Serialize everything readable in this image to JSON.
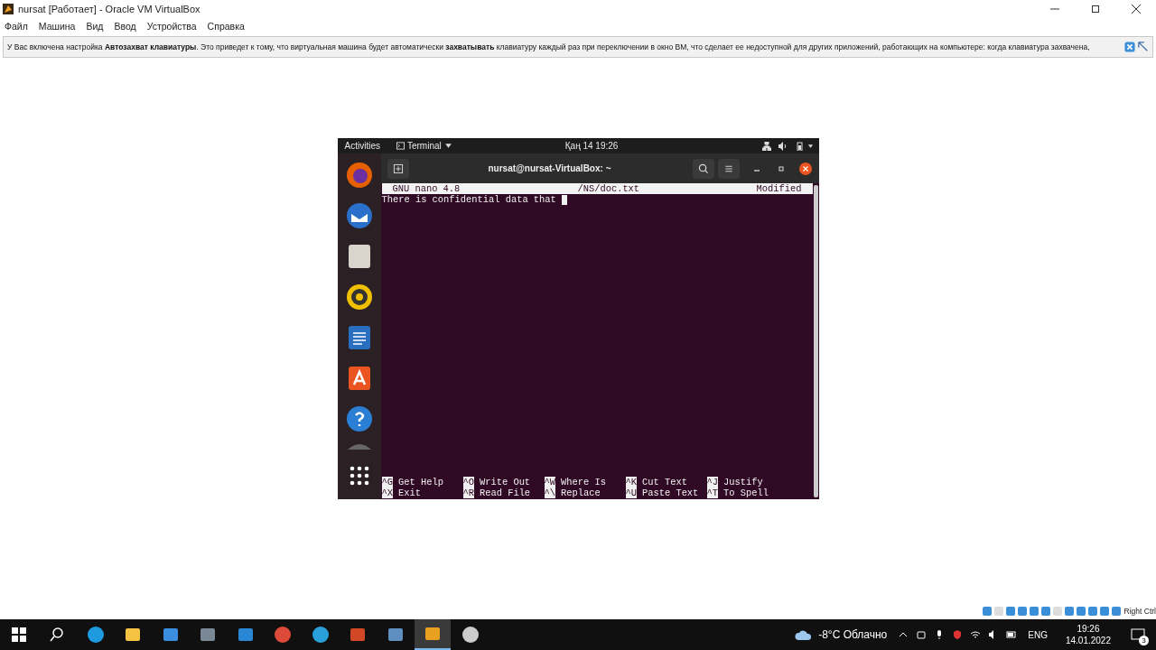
{
  "window": {
    "title": "nursat [Работает] - Oracle VM VirtualBox"
  },
  "menu": [
    "Файл",
    "Машина",
    "Вид",
    "Ввод",
    "Устройства",
    "Справка"
  ],
  "notification": {
    "text": "У Вас включена настройка **Автозахват клавиатуры**. Это приведет к тому, что виртуальная машина будет автоматически **захватывать** клавиатуру каждый раз при переключении в окно ВМ, что сделает ее недоступной для других приложений, работающих на компьютере: когда клавиатура захвачена,"
  },
  "vm": {
    "topbar": {
      "activities": "Activities",
      "app": "Terminal",
      "clock": "Қаң 14  19:26"
    },
    "dock": [
      {
        "kind": "firefox"
      },
      {
        "kind": "thunderbird"
      },
      {
        "kind": "files"
      },
      {
        "kind": "rhythmbox"
      },
      {
        "kind": "writer"
      },
      {
        "kind": "software"
      },
      {
        "kind": "help"
      },
      {
        "kind": "partial"
      },
      {
        "kind": "grid"
      }
    ],
    "terminal": {
      "title": "nursat@nursat-VirtualBox: ~",
      "nano": {
        "app": "GNU nano 4.8",
        "file": "/NS/doc.txt",
        "status": "Modified"
      },
      "lines": [
        "There is confidential data that"
      ],
      "shortcuts": [
        [
          {
            "key": "^G",
            "label": "Get Help"
          },
          {
            "key": "^X",
            "label": "Exit"
          }
        ],
        [
          {
            "key": "^O",
            "label": "Write Out"
          },
          {
            "key": "^R",
            "label": "Read File"
          }
        ],
        [
          {
            "key": "^W",
            "label": "Where Is"
          },
          {
            "key": "^\\",
            "label": "Replace"
          }
        ],
        [
          {
            "key": "^K",
            "label": "Cut Text"
          },
          {
            "key": "^U",
            "label": "Paste Text"
          }
        ],
        [
          {
            "key": "^J",
            "label": "Justify"
          },
          {
            "key": "^T",
            "label": "To Spell"
          }
        ]
      ]
    }
  },
  "host_key": "Right Ctrl",
  "taskbar": {
    "apps": [
      {
        "kind": "edge",
        "selected": false
      },
      {
        "kind": "explorer",
        "selected": false
      },
      {
        "kind": "store",
        "selected": false
      },
      {
        "kind": "camera",
        "selected": false
      },
      {
        "kind": "mail",
        "selected": false
      },
      {
        "kind": "chrome",
        "selected": false
      },
      {
        "kind": "telegram",
        "selected": false
      },
      {
        "kind": "powerpoint",
        "selected": false
      },
      {
        "kind": "virtualbox",
        "selected": false
      },
      {
        "kind": "vm",
        "selected": true
      },
      {
        "kind": "obs",
        "selected": false
      }
    ],
    "weather": "-8°C Облачно",
    "lang": "ENG",
    "time": "19:26",
    "date": "14.01.2022",
    "notifications": "3"
  }
}
